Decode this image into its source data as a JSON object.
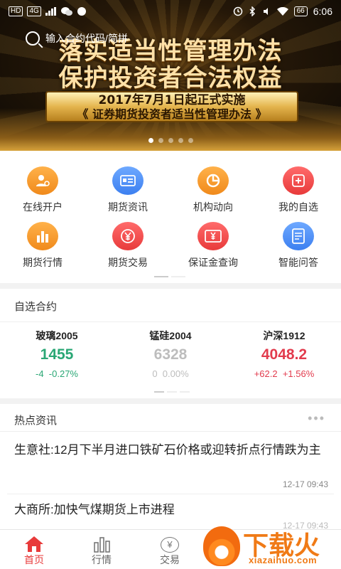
{
  "status_bar": {
    "network_badges": [
      "HD",
      "4G"
    ],
    "battery": "66",
    "time": "6:06"
  },
  "banner": {
    "search_placeholder": "输入合约代码/简拼",
    "headline_1": "落实适当性管理办法",
    "headline_2": "保护投资者合法权益",
    "sub_line_1": "2017年7月1日起正式实施",
    "sub_line_2": "《 证券期货投资者适当性管理办法 》",
    "page_count": 5,
    "active_page": 0
  },
  "quick_menu": [
    {
      "label": "在线开户",
      "icon": "account-open-icon",
      "color": "orange"
    },
    {
      "label": "期货资讯",
      "icon": "news-card-icon",
      "color": "blue"
    },
    {
      "label": "机构动向",
      "icon": "pie-chart-icon",
      "color": "orange"
    },
    {
      "label": "我的自选",
      "icon": "plus-icon",
      "color": "red"
    },
    {
      "label": "期货行情",
      "icon": "bar-chart-icon",
      "color": "orange"
    },
    {
      "label": "期货交易",
      "icon": "yen-icon",
      "color": "red"
    },
    {
      "label": "保证金查询",
      "icon": "yen-card-icon",
      "color": "red"
    },
    {
      "label": "智能问答",
      "icon": "document-icon",
      "color": "blue"
    }
  ],
  "watchlist": {
    "title": "自选合约",
    "contracts": [
      {
        "name": "玻璃2005",
        "price": "1455",
        "change": "-4",
        "change_pct": "-0.27%",
        "trend": "down"
      },
      {
        "name": "锰硅2004",
        "price": "6328",
        "change": "0",
        "change_pct": "0.00%",
        "trend": "flat"
      },
      {
        "name": "沪深1912",
        "price": "4048.2",
        "change": "+62.2",
        "change_pct": "+1.56%",
        "trend": "up"
      }
    ]
  },
  "news": {
    "title": "热点资讯",
    "items": [
      {
        "headline": "生意社:12月下半月进口铁矿石价格或迎转折点行情跌为主",
        "time": "12-17 09:43"
      },
      {
        "headline": "大商所:加快气煤期货上市进程",
        "time": "12-17 09:43"
      }
    ]
  },
  "tabs": [
    {
      "label": "首页",
      "active": true
    },
    {
      "label": "行情",
      "active": false
    },
    {
      "label": "交易",
      "active": false
    }
  ],
  "watermark": {
    "brand": "下载火",
    "site": "xiazaihuo.com"
  },
  "colors": {
    "accent_red": "#e83a3a",
    "down_green": "#2aa775",
    "up_red": "#e23b4d",
    "flat_gray": "#bdbdbd"
  }
}
